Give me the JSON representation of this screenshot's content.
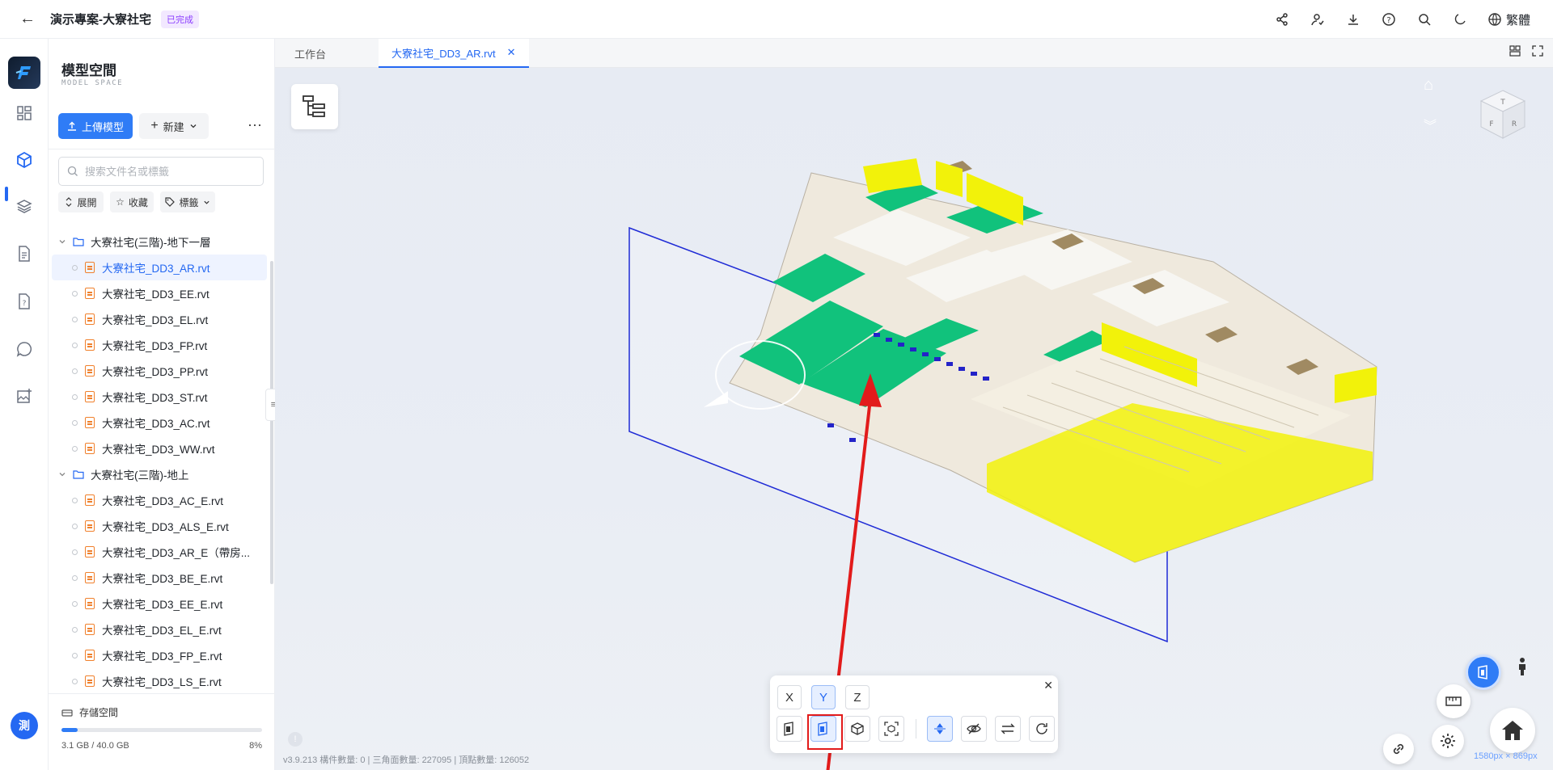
{
  "topbar": {
    "back_icon": "arrow-left-icon",
    "project_title": "演示專案-大寮社宅",
    "status_badge": "已完成",
    "language": "繁體"
  },
  "rail": {
    "avatar_text": "測",
    "items": [
      "dashboard-icon",
      "model-space-icon",
      "layers-icon",
      "document-icon",
      "file-question-icon",
      "chat-icon",
      "image-add-icon"
    ]
  },
  "panel": {
    "title": "模型空間",
    "subtitle": "MODEL SPACE",
    "upload_label": "上傳模型",
    "new_label": "新建",
    "search_placeholder": "搜索文件名或標籤",
    "chips": [
      "展開",
      "收藏",
      "標籤"
    ],
    "folders": [
      {
        "name": "大寮社宅(三階)-地下一層",
        "files": [
          "大寮社宅_DD3_AR.rvt",
          "大寮社宅_DD3_EE.rvt",
          "大寮社宅_DD3_EL.rvt",
          "大寮社宅_DD3_FP.rvt",
          "大寮社宅_DD3_PP.rvt",
          "大寮社宅_DD3_ST.rvt",
          "大寮社宅_DD3_AC.rvt",
          "大寮社宅_DD3_WW.rvt"
        ]
      },
      {
        "name": "大寮社宅(三階)-地上",
        "files": [
          "大寮社宅_DD3_AC_E.rvt",
          "大寮社宅_DD3_ALS_E.rvt",
          "大寮社宅_DD3_AR_E（帶房...",
          "大寮社宅_DD3_BE_E.rvt",
          "大寮社宅_DD3_EE_E.rvt",
          "大寮社宅_DD3_EL_E.rvt",
          "大寮社宅_DD3_FP_E.rvt",
          "大寮社宅_DD3_LS_E.rvt"
        ]
      }
    ],
    "storage": {
      "title": "存儲空間",
      "used": "3.1 GB / 40.0 GB",
      "percent_label": "8%",
      "percent": 0.08
    }
  },
  "tabs": [
    {
      "label": "工作台"
    },
    {
      "label": "大寮社宅_DD3_AR.rvt"
    }
  ],
  "viewer": {
    "viewcube_faces": [
      "T",
      "F",
      "R"
    ],
    "section_axes": [
      "X",
      "Y",
      "Z"
    ],
    "status_line": "v3.9.213   構件數量: 0 | 三角面數量: 227095 | 頂點數量: 126052",
    "resolution": "1580px × 869px",
    "colors": {
      "accent": "#2468f2",
      "floor_green": "#11c27c",
      "wall_yellow": "#f2f20a",
      "section_plane": "#1f2bd6",
      "annotation": "#e21b1b"
    }
  }
}
